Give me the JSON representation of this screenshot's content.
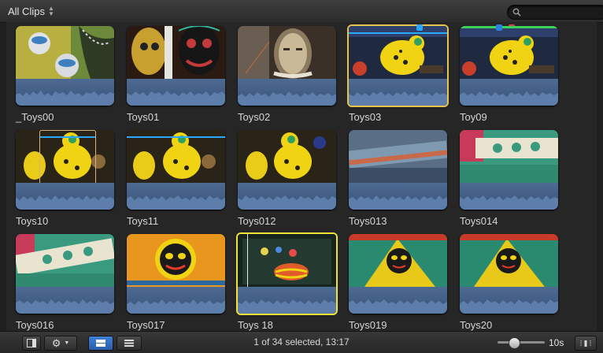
{
  "toolbar": {
    "filter_label": "All Clips",
    "search_placeholder": ""
  },
  "clips": [
    {
      "name": "_Toys00"
    },
    {
      "name": "Toys01"
    },
    {
      "name": "Toys02"
    },
    {
      "name": "Toys03"
    },
    {
      "name": "Toy09"
    },
    {
      "name": "Toys10"
    },
    {
      "name": "Toys11"
    },
    {
      "name": "Toys012"
    },
    {
      "name": "Toys013"
    },
    {
      "name": "Toys014"
    },
    {
      "name": "Toys016"
    },
    {
      "name": "Toys017"
    },
    {
      "name": "Toys 18"
    },
    {
      "name": "Toys019"
    },
    {
      "name": "Toys20"
    }
  ],
  "status": {
    "selection_text": "1 of 34 selected, 13:17"
  },
  "zoom": {
    "label": "10s",
    "level": 0.35
  },
  "colors": {
    "selection": "#e9c34a",
    "range_bar": "#2aa8ff",
    "favorite_bar": "#3cd35a",
    "waveform": "#4d6a92"
  }
}
